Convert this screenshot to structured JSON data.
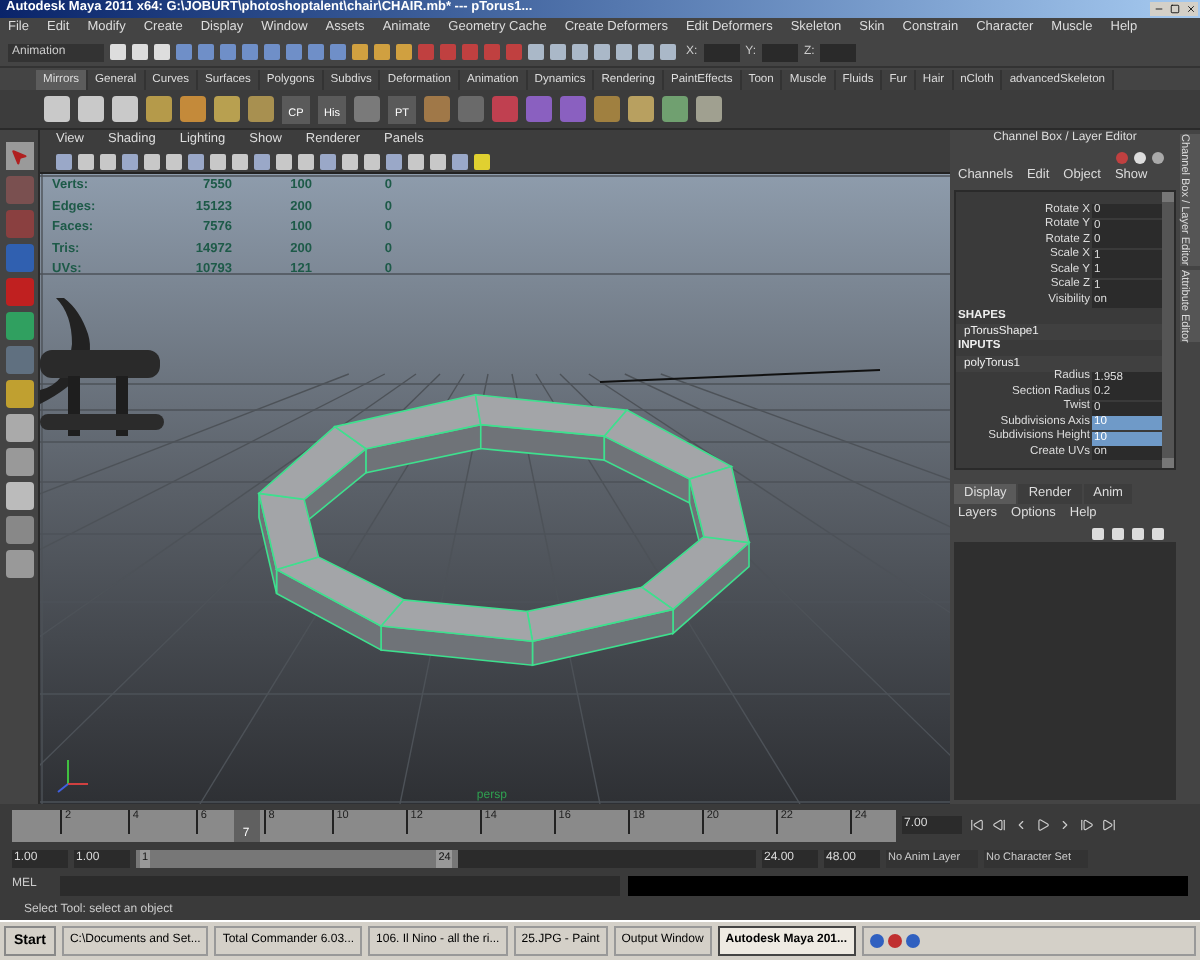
{
  "window": {
    "title": "Autodesk Maya 2011 x64: G:\\JOBURT\\photoshoptalent\\chair\\CHAIR.mb*  ---  pTorus1..."
  },
  "menu": [
    "File",
    "Edit",
    "Modify",
    "Create",
    "Display",
    "Window",
    "Assets",
    "Animate",
    "Geometry Cache",
    "Create Deformers",
    "Edit Deformers",
    "Skeleton",
    "Skin",
    "Constrain",
    "Character",
    "Muscle",
    "Help"
  ],
  "status_line": {
    "menu_set": "Animation",
    "x_label": "X:",
    "y_label": "Y:",
    "z_label": "Z:"
  },
  "shelf_tabs": [
    {
      "label": "Mirrors",
      "selected": true
    },
    {
      "label": "General",
      "selected": false
    },
    {
      "label": "Curves",
      "selected": false
    },
    {
      "label": "Surfaces",
      "selected": false
    },
    {
      "label": "Polygons",
      "selected": false
    },
    {
      "label": "Subdivs",
      "selected": false
    },
    {
      "label": "Deformation",
      "selected": false
    },
    {
      "label": "Animation",
      "selected": false
    },
    {
      "label": "Dynamics",
      "selected": false
    },
    {
      "label": "Rendering",
      "selected": false
    },
    {
      "label": "PaintEffects",
      "selected": false
    },
    {
      "label": "Toon",
      "selected": false
    },
    {
      "label": "Muscle",
      "selected": false
    },
    {
      "label": "Fluids",
      "selected": false
    },
    {
      "label": "Fur",
      "selected": false
    },
    {
      "label": "Hair",
      "selected": false
    },
    {
      "label": "nCloth",
      "selected": false
    },
    {
      "label": "advancedSkeleton",
      "selected": false
    }
  ],
  "shelf_labels": [
    "CP",
    "His",
    "PT"
  ],
  "viewport": {
    "menu": [
      "View",
      "Shading",
      "Lighting",
      "Show",
      "Renderer",
      "Panels"
    ],
    "camera": "persp",
    "stats": [
      {
        "label": "Verts:",
        "column_2": "7550",
        "column_3": "100",
        "column_4": "0"
      },
      {
        "label": "Edges:",
        "column_2": "15123",
        "column_3": "200",
        "column_4": "0"
      },
      {
        "label": "Faces:",
        "column_2": "7576",
        "column_3": "100",
        "column_4": "0"
      },
      {
        "label": "Tris:",
        "column_2": "14972",
        "column_3": "200",
        "column_4": "0"
      },
      {
        "label": "UVs:",
        "column_2": "10793",
        "column_3": "121",
        "column_4": "0"
      }
    ]
  },
  "channel_box": {
    "title": "Channel Box / Layer Editor",
    "menu": [
      "Channels",
      "Edit",
      "Object",
      "Show"
    ],
    "rows": [
      {
        "kind": "attr",
        "label": "Rotate X",
        "value": "0",
        "selected": false
      },
      {
        "kind": "attr",
        "label": "Rotate Y",
        "value": "0",
        "selected": false
      },
      {
        "kind": "attr",
        "label": "Rotate Z",
        "value": "0",
        "selected": false
      },
      {
        "kind": "attr",
        "label": "Scale X",
        "value": "1",
        "selected": false
      },
      {
        "kind": "attr",
        "label": "Scale Y",
        "value": "1",
        "selected": false
      },
      {
        "kind": "attr",
        "label": "Scale Z",
        "value": "1",
        "selected": false
      },
      {
        "kind": "attr",
        "label": "Visibility",
        "value": "on",
        "selected": false
      },
      {
        "kind": "section",
        "label": "SHAPES"
      },
      {
        "kind": "node",
        "label": "pTorusShape1"
      },
      {
        "kind": "section",
        "label": "INPUTS"
      },
      {
        "kind": "node",
        "label": "polyTorus1"
      },
      {
        "kind": "attr",
        "label": "Radius",
        "value": "1.958",
        "selected": false
      },
      {
        "kind": "attr",
        "label": "Section Radius",
        "value": "0.2",
        "selected": false
      },
      {
        "kind": "attr",
        "label": "Twist",
        "value": "0",
        "selected": false
      },
      {
        "kind": "attr",
        "label": "Subdivisions Axis",
        "value": "10",
        "selected": true
      },
      {
        "kind": "attr",
        "label": "Subdivisions Height",
        "value": "10",
        "selected": true
      },
      {
        "kind": "attr",
        "label": "Create UVs",
        "value": "on",
        "selected": false
      }
    ],
    "side_tabs": [
      "Channel Box / Layer Editor",
      "Attribute Editor"
    ]
  },
  "layer_editor": {
    "tabs": [
      {
        "label": "Display",
        "selected": true
      },
      {
        "label": "Render",
        "selected": false
      },
      {
        "label": "Anim",
        "selected": false
      }
    ],
    "menu": [
      "Layers",
      "Options",
      "Help"
    ]
  },
  "timeline": {
    "labels": [
      "2",
      "4",
      "6",
      "8",
      "10",
      "12",
      "14",
      "16",
      "18",
      "20",
      "22",
      "24"
    ],
    "current": "7",
    "level": 0.25,
    "time_field": "7.00"
  },
  "range": {
    "start": "1.00",
    "range_start": "1.00",
    "handle_start": "1",
    "handle_end": "24",
    "level": 0.52,
    "range_end": "24.00",
    "end": "48.00",
    "anim_layer": "No Anim Layer",
    "character_set": "No Character Set"
  },
  "command_line": {
    "label": "MEL"
  },
  "help_line": "Select Tool: select an object",
  "taskbar": {
    "start": "Start",
    "items": [
      {
        "label": "C:\\Documents and Set...",
        "selected": false
      },
      {
        "label": "Total Commander 6.03...",
        "selected": false
      },
      {
        "label": "106. Il Nino - all the ri...",
        "selected": false
      },
      {
        "label": "25.JPG - Paint",
        "selected": false
      },
      {
        "label": "Output Window",
        "selected": false
      },
      {
        "label": "Autodesk Maya 201...",
        "selected": true
      }
    ]
  }
}
